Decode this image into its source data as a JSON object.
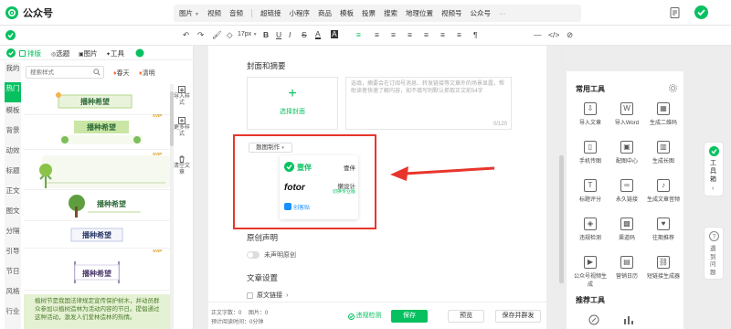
{
  "header": {
    "brand": "公众号",
    "insert_items": [
      "图片",
      "视频",
      "音频",
      "超链接",
      "小程序",
      "商品",
      "模板",
      "投票",
      "搜索",
      "地理位置",
      "视频号",
      "公众号"
    ],
    "more": "···"
  },
  "toolbar": {
    "font_size": "17px",
    "items": [
      "B",
      "U",
      "I",
      "S",
      "A",
      "A",
      "≡",
      "≡",
      "≡",
      "≡",
      "≡",
      "≡",
      "≡",
      "¶",
      "—",
      "</>",
      "⊘"
    ]
  },
  "left": {
    "tabs": [
      "排版",
      "选题",
      "图片",
      "工具"
    ],
    "search_placeholder": "搜索样式",
    "filters": [
      "春天",
      "清明"
    ],
    "categories": [
      "我的",
      "热门",
      "模板",
      "背景",
      "动效",
      "标题",
      "正文",
      "图文",
      "分隔",
      "引导",
      "节日",
      "风格",
      "行业"
    ],
    "active_category": 1,
    "badge": "SVIP",
    "card_titles": [
      "播种希望",
      "播种希望",
      "播种希望",
      "播种希望",
      "播种希望"
    ],
    "text_card": "植树节是我国法律规定宣传保护树木，并动员群众参加以植树造林为活动内容的节日。提倡通过这种活动，激发人们爱林造林的热情。",
    "side_tools": [
      {
        "label": "导入样式",
        "icon": "import-icon"
      },
      {
        "label": "更多样式",
        "icon": "more-styles-icon"
      },
      {
        "label": "清空文章",
        "icon": "trash-icon"
      }
    ]
  },
  "center": {
    "cover_section": "封面和摘要",
    "cover_button": "选择封面",
    "summary_placeholder": "选填，摘要会在订阅号消息、转发链接等文章外的场景显露，帮助读者快速了解内容，如不填写则默认抓取正文前54字",
    "summary_count": "0/120",
    "plugin": {
      "header": "题图制作",
      "rows": [
        {
          "name": "壹伴",
          "label": "壹伴"
        },
        {
          "name": "fotor",
          "label": "懒设计",
          "sub": "切换专业版"
        },
        {
          "name": "创客贴",
          "label": ""
        }
      ]
    },
    "original_section": "原创声明",
    "original_toggle": "未声明原创",
    "article_settings": "文章设置",
    "original_link": "原文链接",
    "word_count": "正文字数：",
    "word_value": "0",
    "word_tail": "图片：0",
    "read_time": "预计阅读时间：",
    "read_value": "0分钟",
    "check": "违规检测",
    "save": "保存",
    "preview": "预览",
    "publish": "保存并群发"
  },
  "right": {
    "section": "常用工具",
    "tools": [
      {
        "label": "导入文章",
        "icon": "import-article-icon"
      },
      {
        "label": "导入Word",
        "icon": "import-word-icon"
      },
      {
        "label": "生成二维码",
        "icon": "qr-code-icon"
      },
      {
        "label": "手机传图",
        "icon": "phone-upload-icon"
      },
      {
        "label": "配图中心",
        "icon": "image-center-icon"
      },
      {
        "label": "生成长图",
        "icon": "long-image-icon"
      },
      {
        "label": "标题评分",
        "icon": "title-score-icon"
      },
      {
        "label": "永久链接",
        "icon": "permanent-link-icon"
      },
      {
        "label": "生成文章音频",
        "icon": "audio-icon"
      },
      {
        "label": "违规检测",
        "icon": "violation-check-icon"
      },
      {
        "label": "渠道码",
        "icon": "channel-code-icon"
      },
      {
        "label": "往期推荐",
        "icon": "recommend-icon"
      },
      {
        "label": "公众号视频生成",
        "icon": "video-generate-icon"
      },
      {
        "label": "营销日历",
        "icon": "calendar-icon"
      },
      {
        "label": "短链接生成器",
        "icon": "short-link-icon"
      }
    ],
    "section2": "推荐工具",
    "float_toolbox": "工具箱",
    "float_help": "遇到问题"
  },
  "colors": {
    "accent": "#07c160",
    "alert": "#e8352c"
  }
}
